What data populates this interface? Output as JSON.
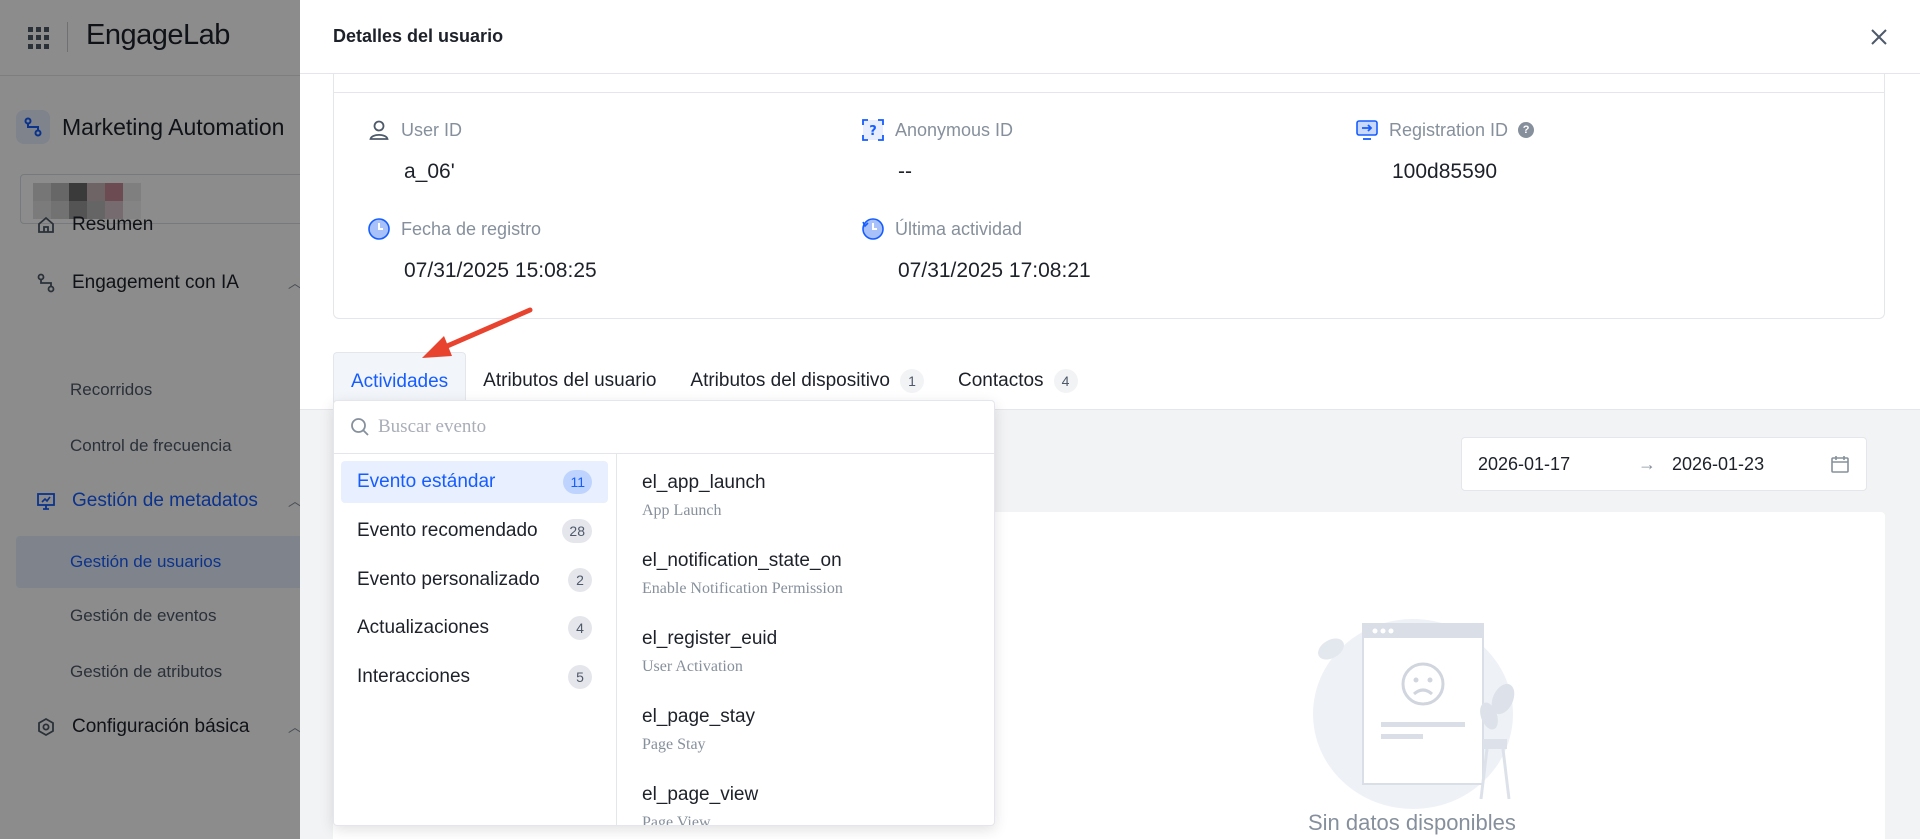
{
  "app": {
    "logo": "EngageLab",
    "product": "Marketing Automation"
  },
  "sidebar": {
    "items": [
      {
        "label": "Resumen",
        "icon": "home-icon"
      },
      {
        "label": "Engagement con IA",
        "icon": "flow-icon"
      },
      {
        "label": "Recorridos"
      },
      {
        "label": "Control de frecuencia"
      },
      {
        "label": "Gestión de metadatos",
        "icon": "monitor-chart-icon"
      },
      {
        "label": "Gestión de usuarios"
      },
      {
        "label": "Gestión de eventos"
      },
      {
        "label": "Gestión de atributos"
      },
      {
        "label": "Configuración básica",
        "icon": "settings-icon"
      }
    ]
  },
  "drawer": {
    "title": "Detalles del usuario",
    "fields": {
      "user_id": {
        "label": "User ID",
        "value": "a_06'"
      },
      "anonymous_id": {
        "label": "Anonymous ID",
        "value": "--"
      },
      "registration_id": {
        "label": "Registration ID",
        "value": "100d85590"
      },
      "registration_date": {
        "label": "Fecha de registro",
        "value": "07/31/2025 15:08:25"
      },
      "last_activity": {
        "label": "Última actividad",
        "value": "07/31/2025 17:08:21"
      }
    },
    "tabs": [
      {
        "label": "Actividades",
        "count": ""
      },
      {
        "label": "Atributos del usuario",
        "count": ""
      },
      {
        "label": "Atributos del dispositivo",
        "count": "1"
      },
      {
        "label": "Contactos",
        "count": "4"
      }
    ],
    "date_range": {
      "start": "2026-01-17",
      "arrow": "→",
      "end": "2026-01-23"
    },
    "empty_text": "Sin datos disponibles"
  },
  "dropdown": {
    "search_placeholder": "Buscar evento",
    "categories": [
      {
        "label": "Evento estándar",
        "count": "11"
      },
      {
        "label": "Evento recomendado",
        "count": "28"
      },
      {
        "label": "Evento personalizado",
        "count": "2"
      },
      {
        "label": "Actualizaciones",
        "count": "4"
      },
      {
        "label": "Interacciones",
        "count": "5"
      }
    ],
    "events": [
      {
        "name": "el_app_launch",
        "desc": "App Launch"
      },
      {
        "name": "el_notification_state_on",
        "desc": "Enable Notification Permission"
      },
      {
        "name": "el_register_euid",
        "desc": "User Activation"
      },
      {
        "name": "el_page_stay",
        "desc": "Page Stay"
      },
      {
        "name": "el_page_view",
        "desc": "Page View"
      }
    ]
  },
  "colors": {
    "accent": "#165dff",
    "annotation_arrow": "#e8432f"
  }
}
